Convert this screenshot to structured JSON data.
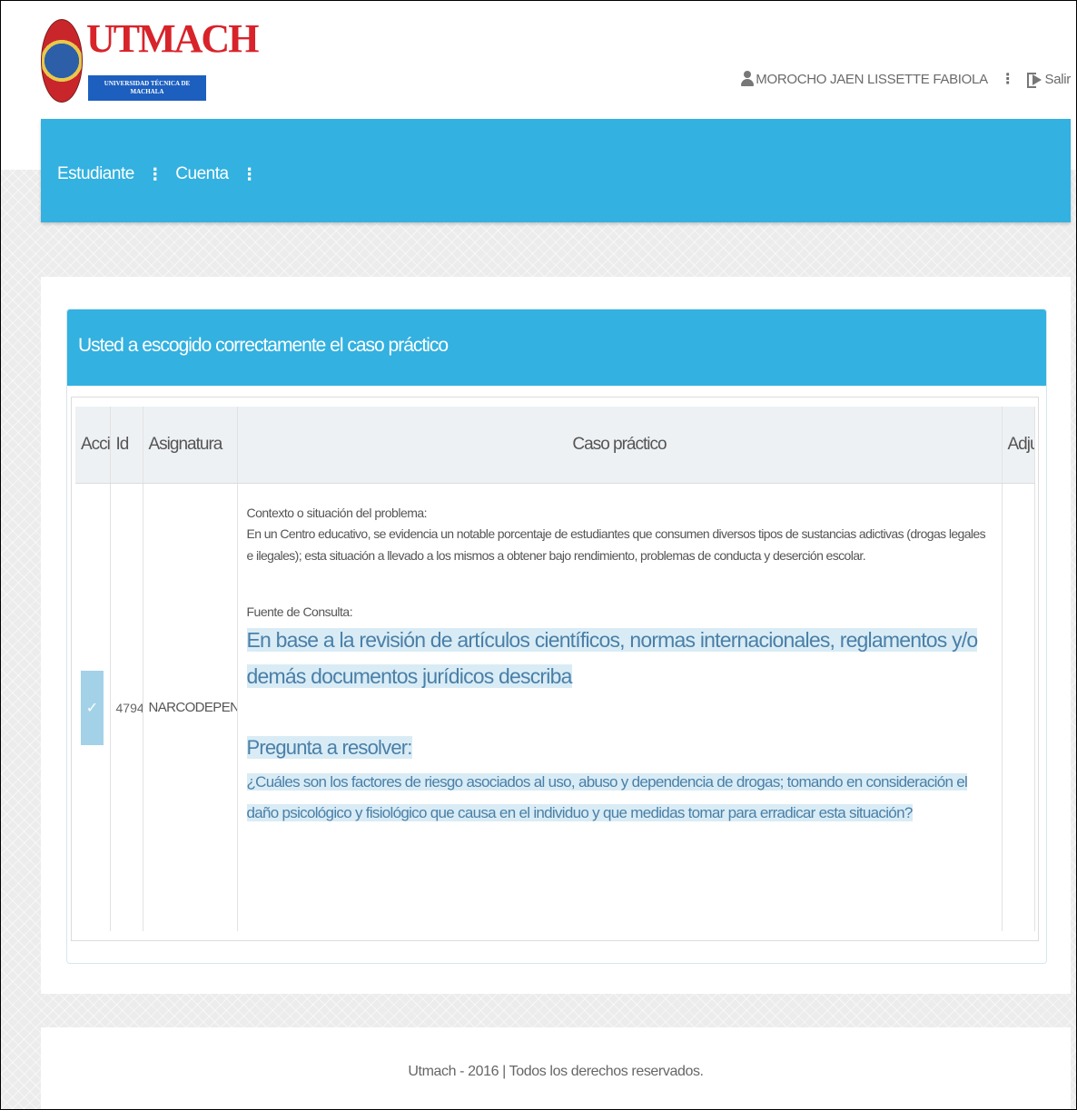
{
  "logo": {
    "name": "UTMACH",
    "subtitle": "UNIVERSIDAD TÉCNICA DE MACHALA"
  },
  "user": {
    "name": "MOROCHO JAEN LISSETTE FABIOLA",
    "logout_label": "Salir"
  },
  "nav": {
    "items": [
      {
        "label": "Estudiante"
      },
      {
        "label": "Cuenta"
      }
    ]
  },
  "panel": {
    "title": "Usted a escogido correctamente el caso práctico"
  },
  "table": {
    "headers": {
      "accion": "Acci",
      "id": "Id",
      "asignatura": "Asignatura",
      "caso": "Caso práctico",
      "adjunto": "Adju"
    },
    "row": {
      "check": "✓",
      "id": "4794",
      "asignatura": "NARCODEPENDENCIA",
      "contexto_label": "Contexto o situación del problema:",
      "contexto_text": "En un Centro educativo, se evidencia un notable porcentaje de estudiantes que consumen diversos tipos de sustancias adictivas (drogas legales e ilegales); esta situación a llevado a los mismos a obtener  bajo rendimiento, problemas de conducta y  deserción escolar.",
      "fuente_label": "Fuente de Consulta:",
      "fuente_text": "En base a la revisión de artículos científicos, normas internacionales, reglamentos y/o demás documentos jurídicos describa",
      "pregunta_label": "Pregunta a resolver:",
      "pregunta_text": "¿Cuáles son los factores de riesgo asociados al uso, abuso y dependencia de drogas; tomando en consideración el daño psicológico y fisiológico que causa en el individuo y que medidas tomar para erradicar esta situación?"
    }
  },
  "footer": {
    "text": "Utmach - 2016 | Todos los derechos reservados."
  },
  "colors": {
    "accent": "#33b1e0",
    "highlight": "#d9ecf5",
    "highlight_text": "#4a7fa8"
  }
}
